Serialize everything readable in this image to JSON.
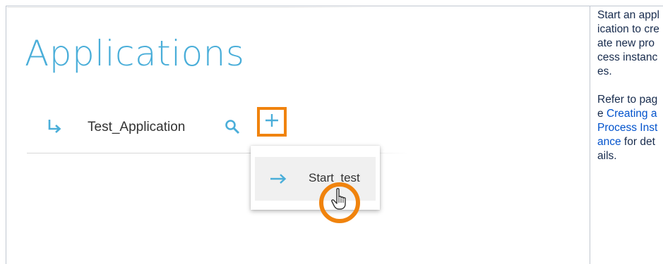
{
  "screenshot": {
    "page_title": "Applications",
    "application_name": "Test_Application",
    "icons": {
      "row": "return-arrow-icon",
      "search": "search-icon",
      "add": "plus-icon",
      "menu": "arrow-right-icon",
      "cursor": "hand-pointer-icon"
    },
    "menu": {
      "items": [
        {
          "label": "Start_test"
        }
      ]
    },
    "colors": {
      "accent": "#4aaed9",
      "highlight": "#f0830d",
      "text": "#333333"
    }
  },
  "description": {
    "text1": "Start an application to create new process instances.",
    "text2_prefix": "Refer to page ",
    "link": "Creating a Process Instance",
    "text2_suffix": " for details."
  }
}
